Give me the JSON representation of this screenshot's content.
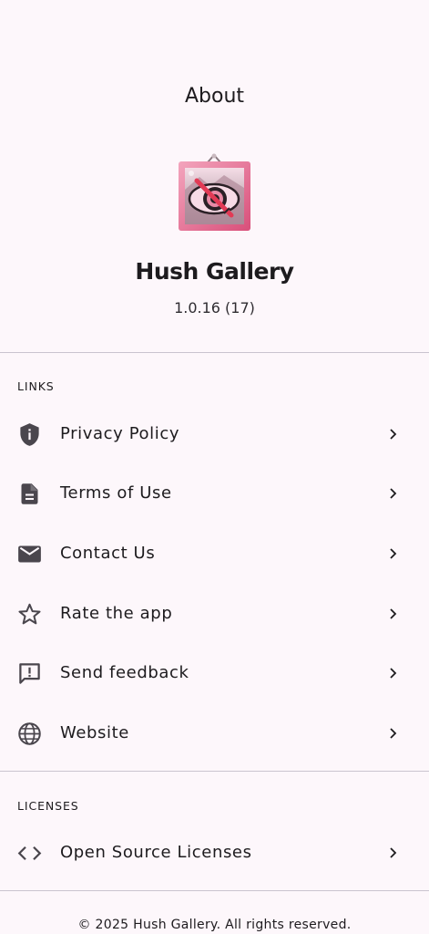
{
  "header": {
    "title": "About"
  },
  "app": {
    "logo_icon": "hush-gallery-logo-icon",
    "name": "Hush Gallery",
    "version": "1.0.16 (17)"
  },
  "links_section": {
    "header": "LINKS",
    "items": [
      {
        "label": "Privacy Policy",
        "icon": "shield-info-icon"
      },
      {
        "label": "Terms of Use",
        "icon": "document-icon"
      },
      {
        "label": "Contact Us",
        "icon": "mail-icon"
      },
      {
        "label": "Rate the app",
        "icon": "star-icon"
      },
      {
        "label": "Send feedback",
        "icon": "feedback-icon"
      },
      {
        "label": "Website",
        "icon": "globe-icon"
      }
    ]
  },
  "licenses_section": {
    "header": "LICENSES",
    "items": [
      {
        "label": "Open Source Licenses",
        "icon": "code-icon"
      }
    ]
  },
  "footer": {
    "copyright": "© 2025 Hush Gallery. All rights reserved."
  },
  "colors": {
    "background": "#fdf7fb",
    "text": "#1d1b1e",
    "icon": "#4a464d",
    "divider": "#cac4cf",
    "logo_pink": "#e0708f",
    "logo_dark": "#5b3a4a"
  }
}
